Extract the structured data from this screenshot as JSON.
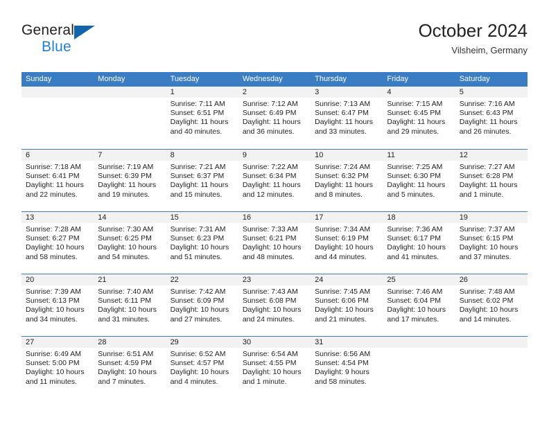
{
  "brand": {
    "line1": "General",
    "line2": "Blue",
    "triangle_color": "#1264ac",
    "blue_color": "#1f7fd4"
  },
  "header": {
    "title": "October 2024",
    "subtitle": "Vilsheim, Germany"
  },
  "theme": {
    "header_blue": "#3b7dc4",
    "band_gray": "#f2f2f2",
    "text": "#222222"
  },
  "weekdays": [
    "Sunday",
    "Monday",
    "Tuesday",
    "Wednesday",
    "Thursday",
    "Friday",
    "Saturday"
  ],
  "weeks": [
    [
      {
        "day": "",
        "sunrise": "",
        "sunset": "",
        "daylight_line1": "",
        "daylight_line2": ""
      },
      {
        "day": "",
        "sunrise": "",
        "sunset": "",
        "daylight_line1": "",
        "daylight_line2": ""
      },
      {
        "day": "1",
        "sunrise": "Sunrise: 7:11 AM",
        "sunset": "Sunset: 6:51 PM",
        "daylight_line1": "Daylight: 11 hours",
        "daylight_line2": "and 40 minutes."
      },
      {
        "day": "2",
        "sunrise": "Sunrise: 7:12 AM",
        "sunset": "Sunset: 6:49 PM",
        "daylight_line1": "Daylight: 11 hours",
        "daylight_line2": "and 36 minutes."
      },
      {
        "day": "3",
        "sunrise": "Sunrise: 7:13 AM",
        "sunset": "Sunset: 6:47 PM",
        "daylight_line1": "Daylight: 11 hours",
        "daylight_line2": "and 33 minutes."
      },
      {
        "day": "4",
        "sunrise": "Sunrise: 7:15 AM",
        "sunset": "Sunset: 6:45 PM",
        "daylight_line1": "Daylight: 11 hours",
        "daylight_line2": "and 29 minutes."
      },
      {
        "day": "5",
        "sunrise": "Sunrise: 7:16 AM",
        "sunset": "Sunset: 6:43 PM",
        "daylight_line1": "Daylight: 11 hours",
        "daylight_line2": "and 26 minutes."
      }
    ],
    [
      {
        "day": "6",
        "sunrise": "Sunrise: 7:18 AM",
        "sunset": "Sunset: 6:41 PM",
        "daylight_line1": "Daylight: 11 hours",
        "daylight_line2": "and 22 minutes."
      },
      {
        "day": "7",
        "sunrise": "Sunrise: 7:19 AM",
        "sunset": "Sunset: 6:39 PM",
        "daylight_line1": "Daylight: 11 hours",
        "daylight_line2": "and 19 minutes."
      },
      {
        "day": "8",
        "sunrise": "Sunrise: 7:21 AM",
        "sunset": "Sunset: 6:37 PM",
        "daylight_line1": "Daylight: 11 hours",
        "daylight_line2": "and 15 minutes."
      },
      {
        "day": "9",
        "sunrise": "Sunrise: 7:22 AM",
        "sunset": "Sunset: 6:34 PM",
        "daylight_line1": "Daylight: 11 hours",
        "daylight_line2": "and 12 minutes."
      },
      {
        "day": "10",
        "sunrise": "Sunrise: 7:24 AM",
        "sunset": "Sunset: 6:32 PM",
        "daylight_line1": "Daylight: 11 hours",
        "daylight_line2": "and 8 minutes."
      },
      {
        "day": "11",
        "sunrise": "Sunrise: 7:25 AM",
        "sunset": "Sunset: 6:30 PM",
        "daylight_line1": "Daylight: 11 hours",
        "daylight_line2": "and 5 minutes."
      },
      {
        "day": "12",
        "sunrise": "Sunrise: 7:27 AM",
        "sunset": "Sunset: 6:28 PM",
        "daylight_line1": "Daylight: 11 hours",
        "daylight_line2": "and 1 minute."
      }
    ],
    [
      {
        "day": "13",
        "sunrise": "Sunrise: 7:28 AM",
        "sunset": "Sunset: 6:27 PM",
        "daylight_line1": "Daylight: 10 hours",
        "daylight_line2": "and 58 minutes."
      },
      {
        "day": "14",
        "sunrise": "Sunrise: 7:30 AM",
        "sunset": "Sunset: 6:25 PM",
        "daylight_line1": "Daylight: 10 hours",
        "daylight_line2": "and 54 minutes."
      },
      {
        "day": "15",
        "sunrise": "Sunrise: 7:31 AM",
        "sunset": "Sunset: 6:23 PM",
        "daylight_line1": "Daylight: 10 hours",
        "daylight_line2": "and 51 minutes."
      },
      {
        "day": "16",
        "sunrise": "Sunrise: 7:33 AM",
        "sunset": "Sunset: 6:21 PM",
        "daylight_line1": "Daylight: 10 hours",
        "daylight_line2": "and 48 minutes."
      },
      {
        "day": "17",
        "sunrise": "Sunrise: 7:34 AM",
        "sunset": "Sunset: 6:19 PM",
        "daylight_line1": "Daylight: 10 hours",
        "daylight_line2": "and 44 minutes."
      },
      {
        "day": "18",
        "sunrise": "Sunrise: 7:36 AM",
        "sunset": "Sunset: 6:17 PM",
        "daylight_line1": "Daylight: 10 hours",
        "daylight_line2": "and 41 minutes."
      },
      {
        "day": "19",
        "sunrise": "Sunrise: 7:37 AM",
        "sunset": "Sunset: 6:15 PM",
        "daylight_line1": "Daylight: 10 hours",
        "daylight_line2": "and 37 minutes."
      }
    ],
    [
      {
        "day": "20",
        "sunrise": "Sunrise: 7:39 AM",
        "sunset": "Sunset: 6:13 PM",
        "daylight_line1": "Daylight: 10 hours",
        "daylight_line2": "and 34 minutes."
      },
      {
        "day": "21",
        "sunrise": "Sunrise: 7:40 AM",
        "sunset": "Sunset: 6:11 PM",
        "daylight_line1": "Daylight: 10 hours",
        "daylight_line2": "and 31 minutes."
      },
      {
        "day": "22",
        "sunrise": "Sunrise: 7:42 AM",
        "sunset": "Sunset: 6:09 PM",
        "daylight_line1": "Daylight: 10 hours",
        "daylight_line2": "and 27 minutes."
      },
      {
        "day": "23",
        "sunrise": "Sunrise: 7:43 AM",
        "sunset": "Sunset: 6:08 PM",
        "daylight_line1": "Daylight: 10 hours",
        "daylight_line2": "and 24 minutes."
      },
      {
        "day": "24",
        "sunrise": "Sunrise: 7:45 AM",
        "sunset": "Sunset: 6:06 PM",
        "daylight_line1": "Daylight: 10 hours",
        "daylight_line2": "and 21 minutes."
      },
      {
        "day": "25",
        "sunrise": "Sunrise: 7:46 AM",
        "sunset": "Sunset: 6:04 PM",
        "daylight_line1": "Daylight: 10 hours",
        "daylight_line2": "and 17 minutes."
      },
      {
        "day": "26",
        "sunrise": "Sunrise: 7:48 AM",
        "sunset": "Sunset: 6:02 PM",
        "daylight_line1": "Daylight: 10 hours",
        "daylight_line2": "and 14 minutes."
      }
    ],
    [
      {
        "day": "27",
        "sunrise": "Sunrise: 6:49 AM",
        "sunset": "Sunset: 5:00 PM",
        "daylight_line1": "Daylight: 10 hours",
        "daylight_line2": "and 11 minutes."
      },
      {
        "day": "28",
        "sunrise": "Sunrise: 6:51 AM",
        "sunset": "Sunset: 4:59 PM",
        "daylight_line1": "Daylight: 10 hours",
        "daylight_line2": "and 7 minutes."
      },
      {
        "day": "29",
        "sunrise": "Sunrise: 6:52 AM",
        "sunset": "Sunset: 4:57 PM",
        "daylight_line1": "Daylight: 10 hours",
        "daylight_line2": "and 4 minutes."
      },
      {
        "day": "30",
        "sunrise": "Sunrise: 6:54 AM",
        "sunset": "Sunset: 4:55 PM",
        "daylight_line1": "Daylight: 10 hours",
        "daylight_line2": "and 1 minute."
      },
      {
        "day": "31",
        "sunrise": "Sunrise: 6:56 AM",
        "sunset": "Sunset: 4:54 PM",
        "daylight_line1": "Daylight: 9 hours",
        "daylight_line2": "and 58 minutes."
      },
      {
        "day": "",
        "sunrise": "",
        "sunset": "",
        "daylight_line1": "",
        "daylight_line2": ""
      },
      {
        "day": "",
        "sunrise": "",
        "sunset": "",
        "daylight_line1": "",
        "daylight_line2": ""
      }
    ]
  ]
}
